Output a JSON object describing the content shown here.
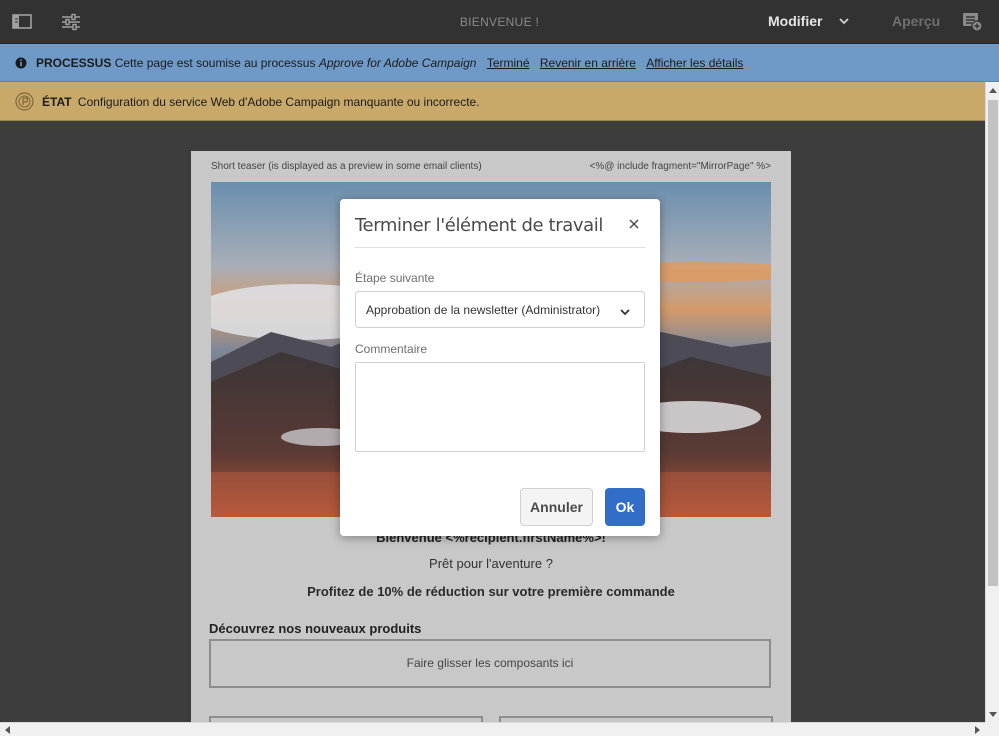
{
  "topbar": {
    "title": "BIENVENUE !",
    "mode_label": "Modifier",
    "preview_label": "Aperçu",
    "icons": [
      "side-panel-icon",
      "properties-icon",
      "chevron-down-icon",
      "annotations-icon"
    ]
  },
  "process": {
    "label": "PROCESSUS",
    "text_prefix": "Cette page est soumise au processus",
    "workflow_name": "Approve for Adobe Campaign",
    "links": [
      "Terminé",
      "Revenir en arrière",
      "Afficher les détails"
    ],
    "color": "#6f9ac8"
  },
  "status": {
    "label": "ÉTAT",
    "message": "Configuration du service Web d'Adobe Campaign manquante ou incorrecte.",
    "color": "#c8a96a"
  },
  "email": {
    "teaser": "Short teaser (is displayed as a preview in some email clients)",
    "mirror": "<%@ include fragment=\"MirrorPage\" %>",
    "welcome": "Bienvenue <%recipient.firstName%>!",
    "ready": "Prêt pour l'aventure ?",
    "offer": "Profitez de 10% de réduction sur votre première commande",
    "discover": "Découvrez nos nouveaux produits",
    "dropzone": "Faire glisser les composants ici"
  },
  "dialog": {
    "title": "Terminer l'élément de travail",
    "next_step_label": "Étape suivante",
    "next_step_value": "Approbation de la newsletter (Administrator)",
    "comment_label": "Commentaire",
    "comment_value": "",
    "cancel_label": "Annuler",
    "ok_label": "Ok",
    "ok_color": "#326ec8"
  }
}
